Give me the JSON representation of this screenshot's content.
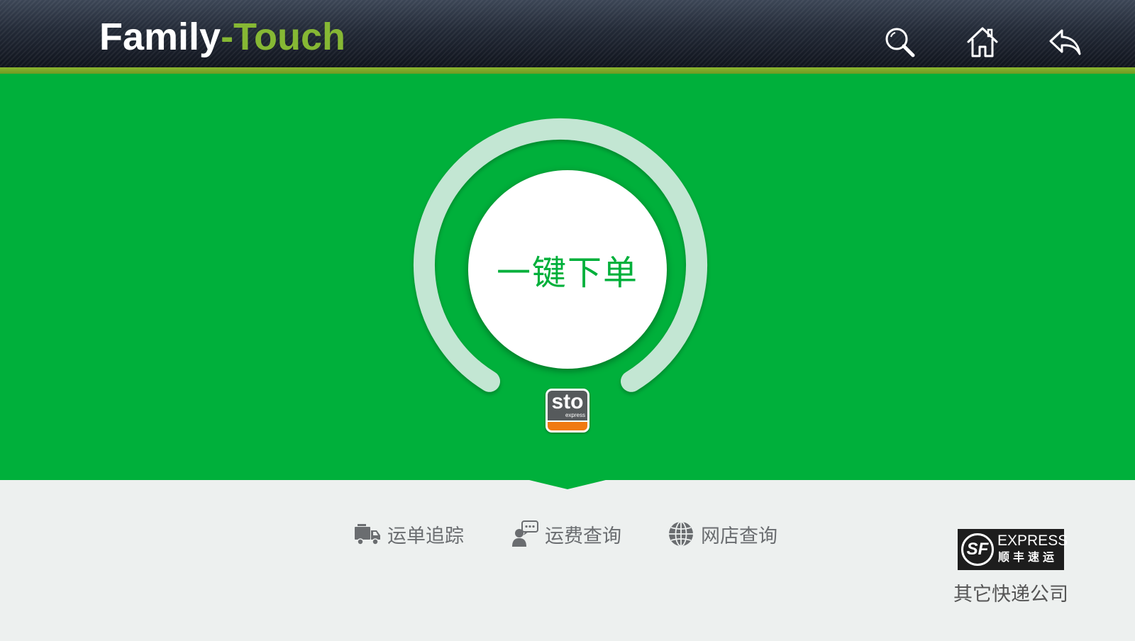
{
  "header": {
    "brand_part1": "Family",
    "brand_part2": "-Touch",
    "search_icon": "search-icon",
    "home_icon": "home-icon",
    "back_icon": "back-arrow-icon"
  },
  "main": {
    "order_button_label": "一键下单",
    "carrier_logo": {
      "name": "sto",
      "sub": "express"
    }
  },
  "nav": {
    "items": [
      {
        "label": "运单追踪",
        "icon": "truck-icon"
      },
      {
        "label": "运费查询",
        "icon": "customer-service-icon"
      },
      {
        "label": "网店查询",
        "icon": "globe-icon"
      }
    ]
  },
  "other_carriers": {
    "logo_mark": "SF",
    "logo_en": "EXPRESS",
    "logo_cn": "顺丰速运",
    "label": "其它快递公司"
  },
  "colors": {
    "header_dark": "#1b2130",
    "accent_green": "#8ab42f",
    "stage_green": "#00b03b",
    "ring": "#c3e6d3",
    "footer_bg": "#edf0ef",
    "sto_orange": "#f07a12"
  }
}
